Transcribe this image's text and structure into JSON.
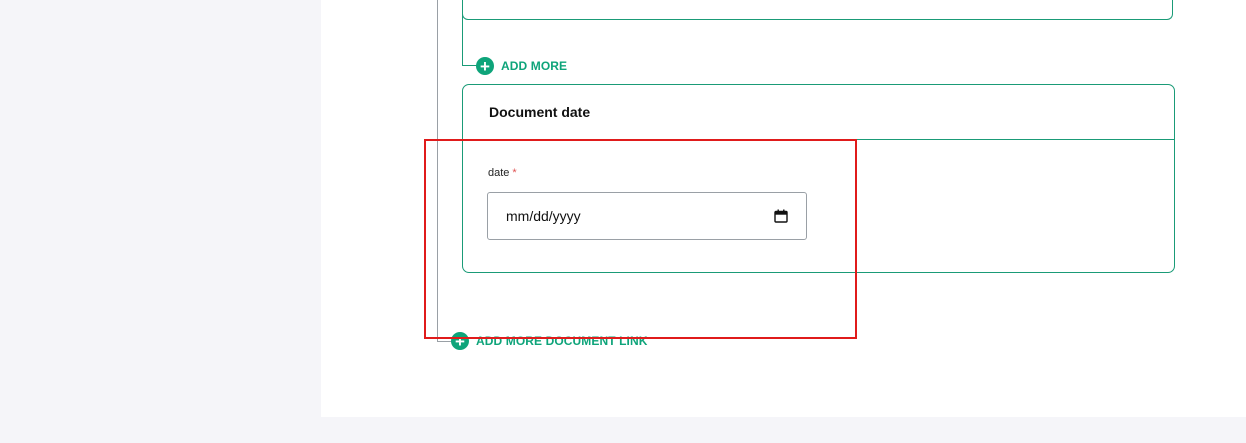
{
  "form": {
    "add_more_label": "ADD MORE",
    "document_date_card": {
      "title": "Document date",
      "date_field": {
        "label": "date",
        "required_marker": "*",
        "placeholder": "mm/dd/yyyy"
      }
    },
    "add_more_document_link_label": "ADD MORE DOCUMENT LINK"
  },
  "colors": {
    "accent": "#0ea47a",
    "border": "#1a9b77",
    "highlight": "#e01b1b",
    "page_bg": "#f5f5f9"
  },
  "icons": {
    "add": "plus-circle-icon",
    "calendar": "calendar-icon"
  }
}
